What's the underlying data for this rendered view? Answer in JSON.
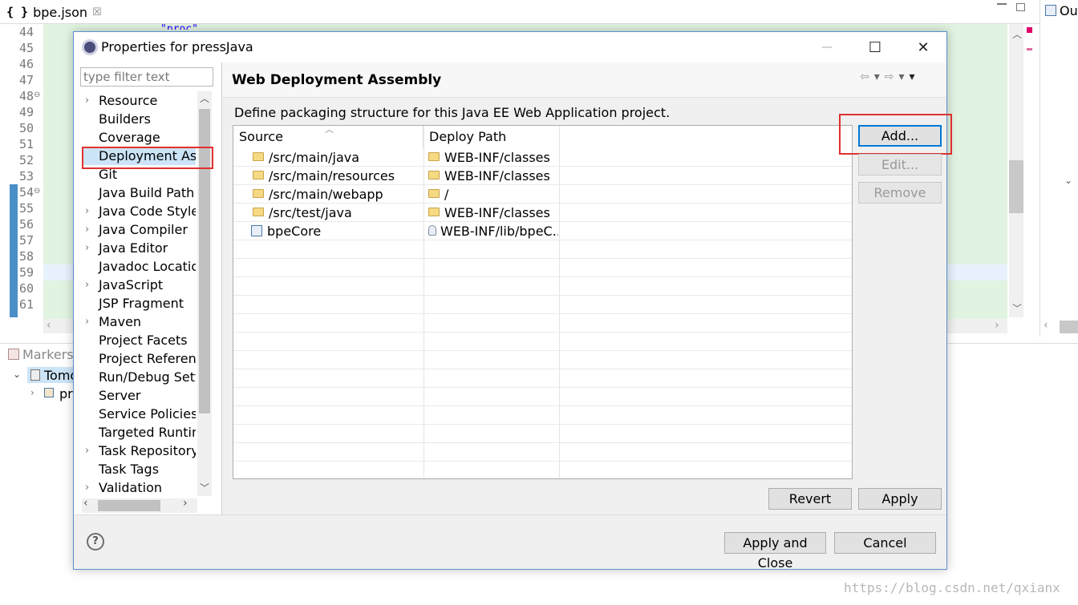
{
  "editor": {
    "tab_label": "bpe.json",
    "tab_brace": "{ }",
    "tab_close": "☒",
    "line_numbers": [
      "44",
      "45",
      "46",
      "47",
      "48",
      "49",
      "50",
      "51",
      "52",
      "53",
      "54",
      "55",
      "56",
      "57",
      "58",
      "59",
      "60",
      "61"
    ],
    "fold_marks": [
      "⊖",
      "⊖"
    ],
    "snippet": "\"proc\""
  },
  "outline": {
    "label": "Ou"
  },
  "markers": {
    "label": "Markers",
    "tree_item_1": "Tomc",
    "tree_item_2": "pr"
  },
  "dialog": {
    "title": "Properties for pressJava",
    "minimize": "—",
    "maximize": "☐",
    "close": "✕",
    "filter_placeholder": "type filter text",
    "tree_items": [
      {
        "label": "Resource",
        "expandable": true
      },
      {
        "label": "Builders",
        "expandable": false
      },
      {
        "label": "Coverage",
        "expandable": false
      },
      {
        "label": "Deployment Assembly",
        "expandable": false,
        "selected": true
      },
      {
        "label": "Git",
        "expandable": false
      },
      {
        "label": "Java Build Path",
        "expandable": false
      },
      {
        "label": "Java Code Style",
        "expandable": true
      },
      {
        "label": "Java Compiler",
        "expandable": true
      },
      {
        "label": "Java Editor",
        "expandable": true
      },
      {
        "label": "Javadoc Location",
        "expandable": false
      },
      {
        "label": "JavaScript",
        "expandable": true
      },
      {
        "label": "JSP Fragment",
        "expandable": false
      },
      {
        "label": "Maven",
        "expandable": true
      },
      {
        "label": "Project Facets",
        "expandable": false
      },
      {
        "label": "Project References",
        "expandable": false
      },
      {
        "label": "Run/Debug Settings",
        "expandable": false
      },
      {
        "label": "Server",
        "expandable": false
      },
      {
        "label": "Service Policies",
        "expandable": false
      },
      {
        "label": "Targeted Runtimes",
        "expandable": false
      },
      {
        "label": "Task Repository",
        "expandable": true
      },
      {
        "label": "Task Tags",
        "expandable": false
      },
      {
        "label": "Validation",
        "expandable": true
      }
    ],
    "page_title": "Web Deployment Assembly",
    "description": "Define packaging structure for this Java EE Web Application project.",
    "table": {
      "columns": [
        "Source",
        "Deploy Path"
      ],
      "rows": [
        {
          "source": "/src/main/java",
          "deploy": "WEB-INF/classes",
          "kind": "folder"
        },
        {
          "source": "/src/main/resources",
          "deploy": "WEB-INF/classes",
          "kind": "folder"
        },
        {
          "source": "/src/main/webapp",
          "deploy": "/",
          "kind": "folder"
        },
        {
          "source": "/src/test/java",
          "deploy": "WEB-INF/classes",
          "kind": "folder"
        },
        {
          "source": "bpeCore",
          "deploy": "WEB-INF/lib/bpeC...",
          "kind": "project"
        }
      ]
    },
    "buttons": {
      "add": "Add...",
      "edit": "Edit...",
      "remove": "Remove",
      "revert": "Revert",
      "apply": "Apply",
      "apply_close": "Apply and Close",
      "cancel": "Cancel",
      "help": "?"
    }
  },
  "watermark": "https://blog.csdn.net/qxianx",
  "colors": {
    "accent": "#0078d7",
    "highlight": "#e03030",
    "editor_bg": "#e1f3e1"
  }
}
